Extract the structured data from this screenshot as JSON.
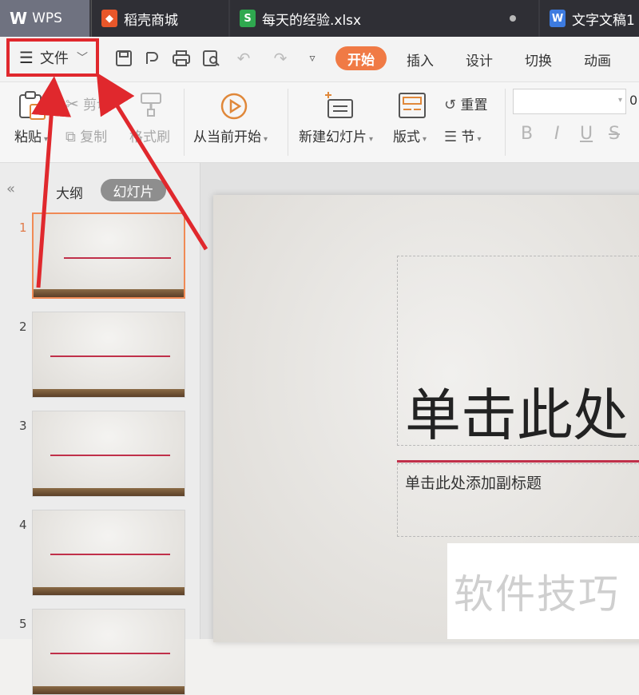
{
  "tabs": [
    {
      "label": "WPS",
      "icon": "wps-logo-icon"
    },
    {
      "label": "稻壳商城",
      "icon": "docer-icon",
      "icon_color": "#e8572a"
    },
    {
      "label": "每天的经验.xlsx",
      "icon": "spreadsheet-icon",
      "icon_color": "#2fa84f"
    },
    {
      "label": "文字文稿1",
      "icon": "writer-icon",
      "icon_color": "#3d7be0"
    }
  ],
  "toolbar": {
    "file_label": "文件",
    "menu_tabs": [
      "开始",
      "插入",
      "设计",
      "切换",
      "动画"
    ],
    "active_tab_color": "#f07a45"
  },
  "ribbon": {
    "paste": "粘贴",
    "cut": "剪切",
    "copy": "复制",
    "format_painter": "格式刷",
    "from_current": "从当前开始",
    "new_slide": "新建幻灯片",
    "layout": "版式",
    "reset": "重置",
    "section": "节",
    "font_size_value": "0",
    "format_buttons": [
      "B",
      "I",
      "U",
      "S"
    ]
  },
  "left_panel": {
    "outline_tab": "大纲",
    "slides_tab": "幻灯片",
    "thumbnails": [
      "1",
      "2",
      "3",
      "4",
      "5"
    ]
  },
  "slide": {
    "title": "单击此处",
    "subtitle": "单击此处添加副标题",
    "accent_color": "#c0304a"
  },
  "watermark": "软件技巧",
  "annotation_color": "#e0282d"
}
